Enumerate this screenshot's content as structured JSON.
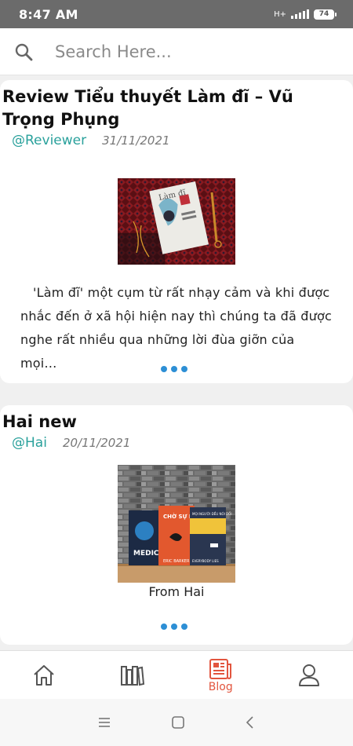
{
  "status_bar": {
    "time": "8:47 AM",
    "network": "H+",
    "battery": "74"
  },
  "search": {
    "placeholder": "Search Here..."
  },
  "posts": [
    {
      "title": "Review Tiểu thuyết Làm đĩ – Vũ Trọng Phụng",
      "author": "@Reviewer",
      "date": "31/11/2021",
      "cover_text": "Làm đĩ",
      "excerpt": "'Làm đĩ' một cụm từ rất nhạy cảm và khi được nhắc đến ở xã hội hiện nay thì chúng ta đã được nghe rất nhiều qua những lời đùa giỡn của mọi…"
    },
    {
      "title": "Hai new",
      "author": "@Hai",
      "date": "20/11/2021",
      "caption": "From Hai",
      "book_titles": [
        "MEDIC",
        "CHỜ SỰ NHẦM C",
        "MỌI NGƯỜI ĐỀU NÓI DỐI"
      ],
      "book_authors": [
        "",
        "ERIC BARKER",
        "EVERYBODY LIES"
      ]
    }
  ],
  "bottom_nav": {
    "active_color": "#e2553e",
    "items": [
      {
        "icon": "home-icon",
        "label": ""
      },
      {
        "icon": "library-icon",
        "label": ""
      },
      {
        "icon": "blog-icon",
        "label": "Blog"
      },
      {
        "icon": "profile-icon",
        "label": ""
      }
    ]
  },
  "accent_colors": {
    "author": "#2aa19c",
    "dots": "#2d8fd5"
  }
}
